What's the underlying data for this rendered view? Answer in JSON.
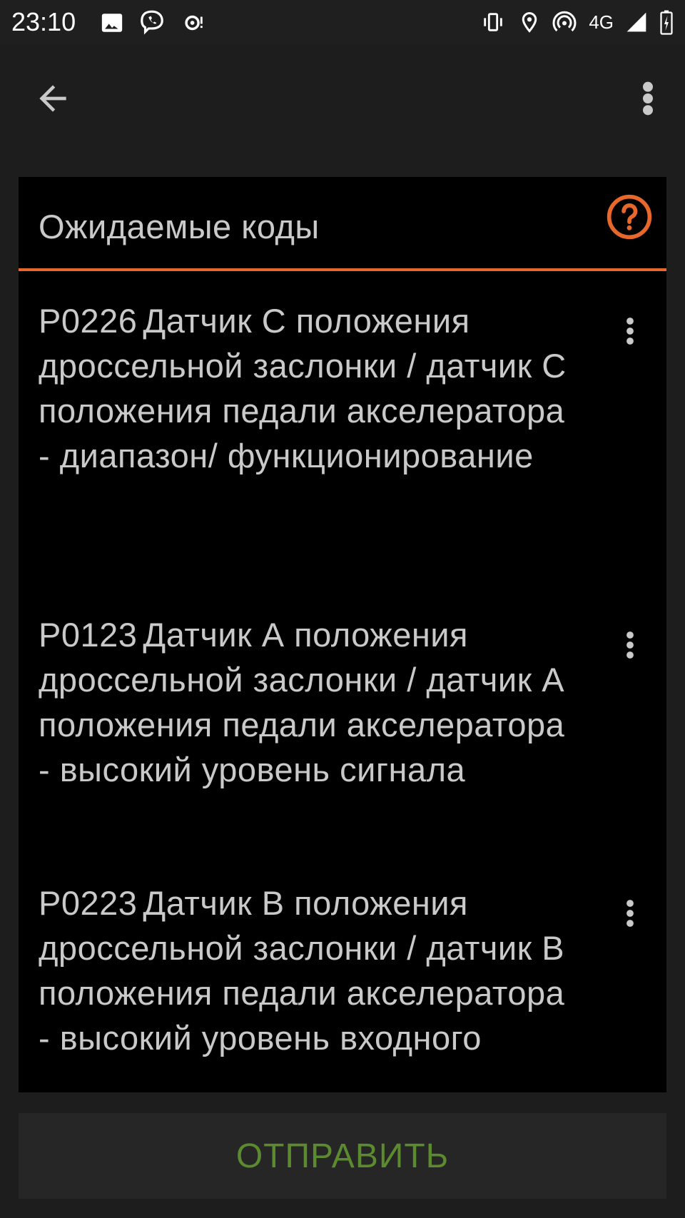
{
  "status_bar": {
    "time": "23:10",
    "network": "4G",
    "icons": [
      "image-icon",
      "viber-icon",
      "sync-icon",
      "vibrate-icon",
      "location-icon",
      "hotspot-icon",
      "signal-icon",
      "battery-icon"
    ]
  },
  "toolbar": {
    "back_icon": "arrow-back-icon",
    "menu_icon": "more-vert-icon"
  },
  "card": {
    "title": "Ожидаемые коды",
    "help_icon": "help-circle-icon",
    "accent_color": "#e8672a",
    "items": [
      {
        "code": "P0226",
        "description": "Датчик С положения дроссельной заслонки / датчик С положения педали акселератора - диапазон/ функционирование"
      },
      {
        "code": "P0123",
        "description": "Датчик А положения дроссельной заслонки / датчик А положения педали акселератора - высокий уровень сигнала"
      },
      {
        "code": "P0223",
        "description": "Датчик В положения дроссельной заслонки / датчик В положения педали акселератора - высокий уровень входного"
      }
    ]
  },
  "actions": {
    "send_label": "ОТПРАВИТЬ",
    "send_color": "#5c8a2f"
  }
}
